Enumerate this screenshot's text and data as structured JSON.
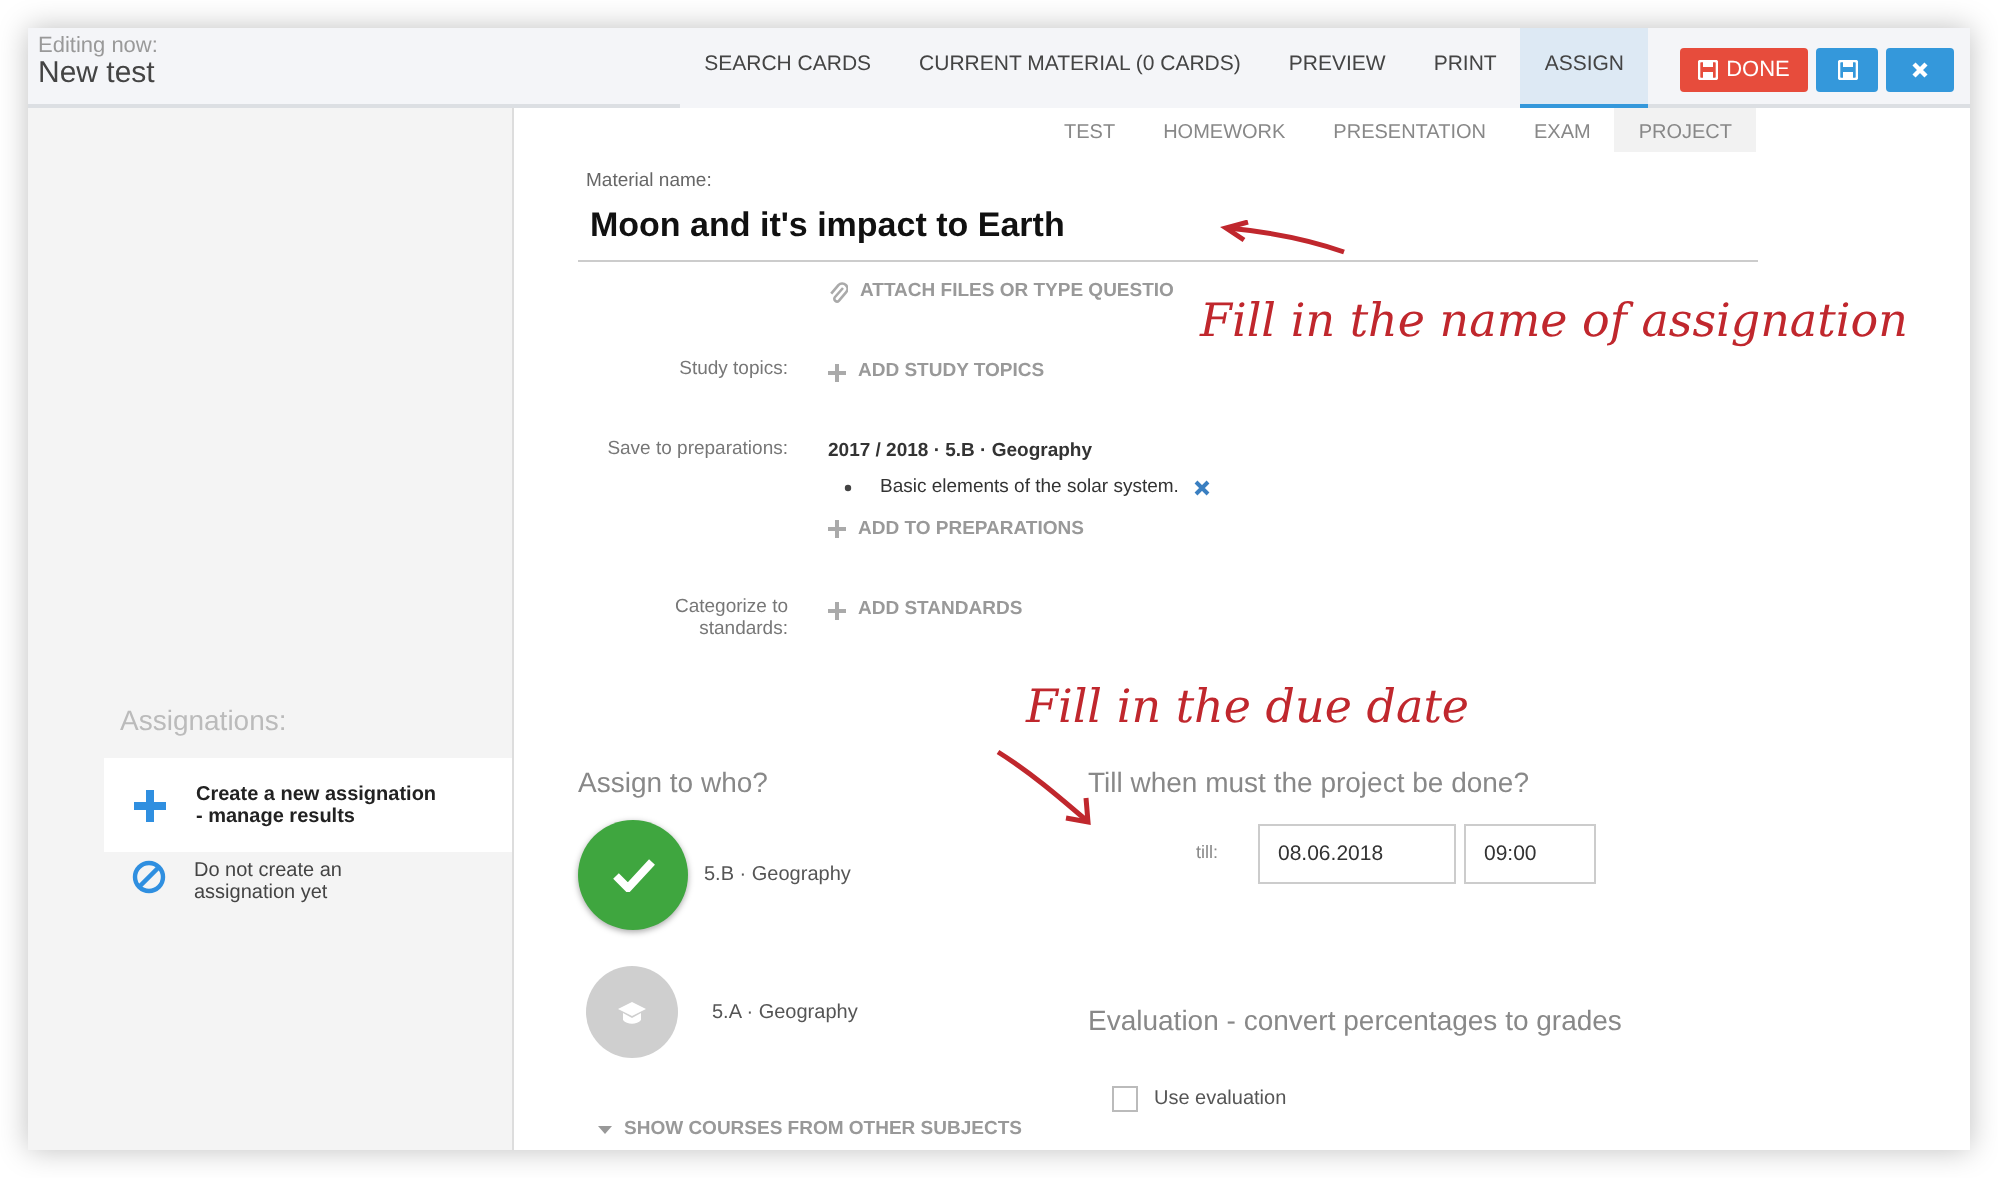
{
  "header": {
    "caption": "Editing now:",
    "title": "New test"
  },
  "tabs": [
    {
      "label": "SEARCH CARDS",
      "selected": false
    },
    {
      "label": "CURRENT MATERIAL (0 CARDS)",
      "selected": false
    },
    {
      "label": "PREVIEW",
      "selected": false
    },
    {
      "label": "PRINT",
      "selected": false
    },
    {
      "label": "ASSIGN",
      "selected": true
    }
  ],
  "actions": [
    {
      "kind": "done",
      "label": "DONE"
    },
    {
      "kind": "save"
    },
    {
      "kind": "close"
    }
  ],
  "material_types": [
    {
      "label": "TEST",
      "selected": false
    },
    {
      "label": "HOMEWORK",
      "selected": false
    },
    {
      "label": "PRESENTATION",
      "selected": false
    },
    {
      "label": "EXAM",
      "selected": false
    },
    {
      "label": "PROJECT",
      "selected": true
    }
  ],
  "material_name": {
    "label": "Material name:",
    "value": "Moon and it's impact to Earth"
  },
  "attach": "ATTACH FILES OR TYPE QUESTIO",
  "fields": [
    {
      "label": "Study topics:",
      "add": "ADD STUDY TOPICS"
    },
    {
      "label": "Save to preparations:",
      "group": "2017 / 2018 · 5.B · Geography",
      "items": [
        "Basic elements of the solar system."
      ],
      "add": "ADD TO PREPARATIONS"
    },
    {
      "label": "Categorize to standards:",
      "add": "ADD STANDARDS"
    }
  ],
  "sidebar": {
    "title": "Assignations:",
    "options": [
      {
        "kind": "create",
        "label": "Create a new assignation\n- manage results",
        "selected": true
      },
      {
        "kind": "none",
        "label": "Do not create an\nassignation yet",
        "selected": false
      }
    ]
  },
  "assign": {
    "title": "Assign to who?",
    "courses": [
      {
        "label": "5.B · Geography",
        "selected": true
      },
      {
        "label": "5.A · Geography",
        "selected": false
      }
    ],
    "more": "SHOW COURSES FROM OTHER SUBJECTS"
  },
  "due": {
    "title": "Till when must the project be done?",
    "label": "till:",
    "date": "08.06.2018",
    "time": "09:00"
  },
  "evaluation": {
    "title": "Evaluation - convert percentages to grades",
    "checkbox": {
      "label": "Use evaluation",
      "checked": false
    }
  },
  "annotations": [
    {
      "text": "Fill in the name of assignation"
    },
    {
      "text": "Fill in the due date"
    }
  ]
}
